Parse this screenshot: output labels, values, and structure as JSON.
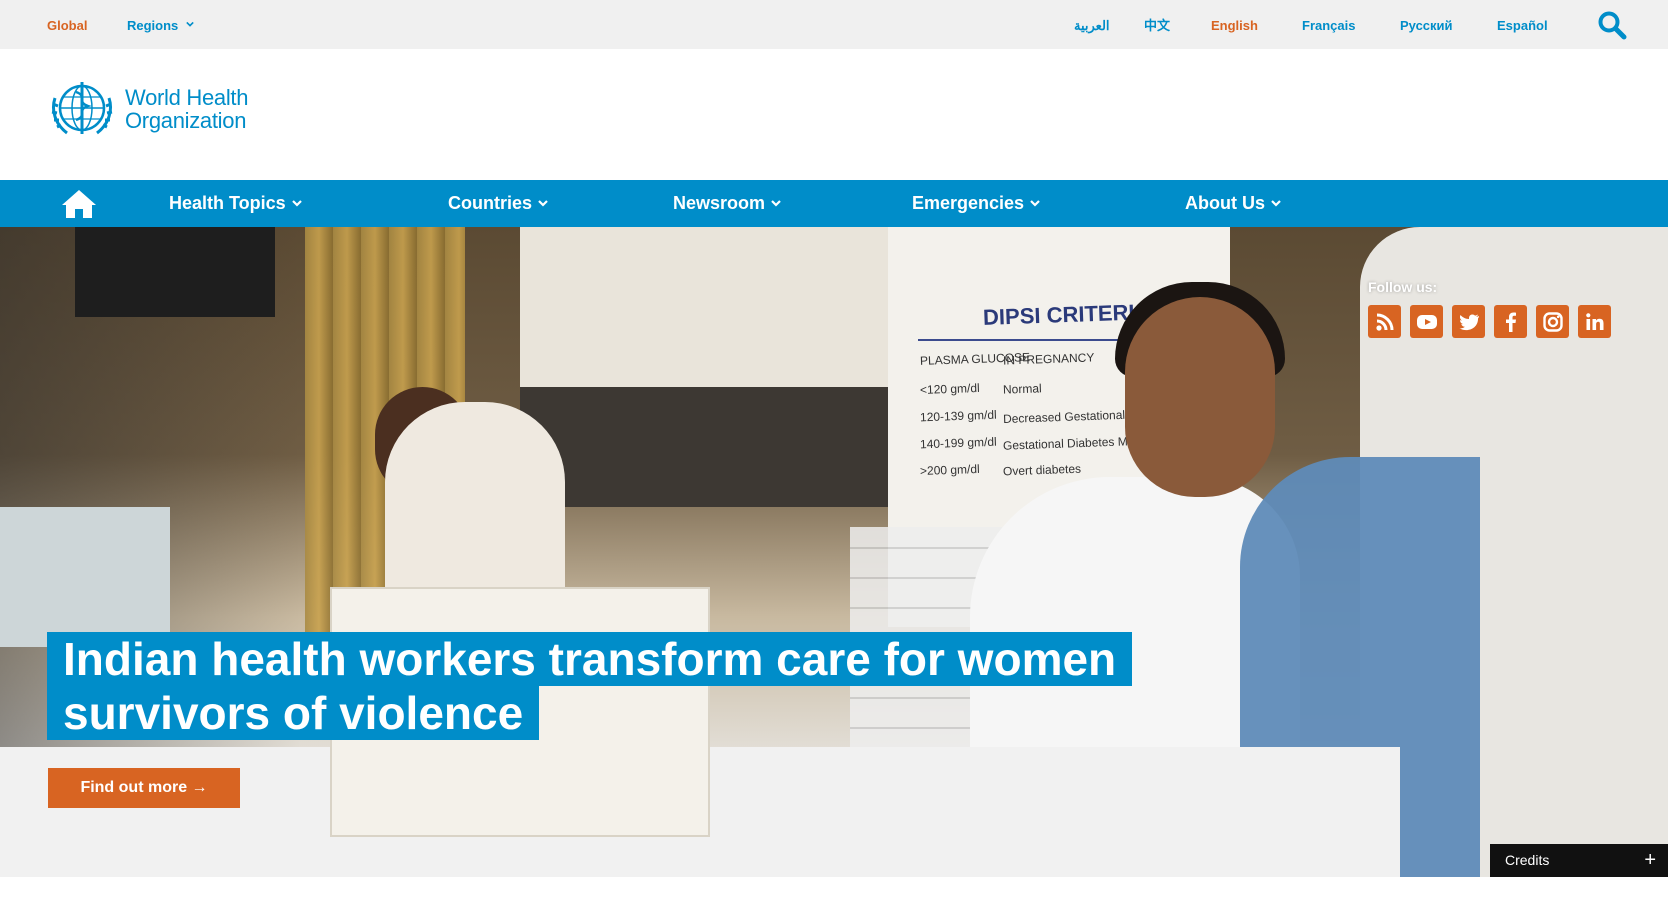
{
  "topbar": {
    "global_label": "Global",
    "regions_label": "Regions",
    "languages": [
      "العربية",
      "中文",
      "English",
      "Français",
      "Русский",
      "Español"
    ],
    "active_language": "English"
  },
  "header": {
    "logo_line1": "World Health",
    "logo_line2": "Organization"
  },
  "nav": {
    "items": [
      "Health Topics",
      "Countries",
      "Newsroom",
      "Emergencies",
      "About Us"
    ]
  },
  "hero": {
    "headline_line1": "Indian health workers transform care for women",
    "headline_line2": "survivors of violence",
    "cta_label": "Find out more →",
    "follow_label": "Follow us:",
    "socials": [
      "rss-icon",
      "youtube-icon",
      "twitter-icon",
      "facebook-icon",
      "instagram-icon",
      "linkedin-icon"
    ],
    "credits_label": "Credits",
    "poster": {
      "title": "DIPSI CRITERIA",
      "col1": "PLASMA GLUCOSE",
      "col2": "IN PREGNANCY",
      "rows": [
        [
          "<120 gm/dl",
          "Normal"
        ],
        [
          "120-139 gm/dl",
          "Decreased Gestational glucose t"
        ],
        [
          "140-199 gm/dl",
          "Gestational Diabetes Mellitus"
        ],
        [
          ">200 gm/dl",
          "Overt diabetes"
        ]
      ]
    }
  },
  "colors": {
    "brand_blue": "#008dc9",
    "accent_orange": "#d86422",
    "topbar_bg": "#f0f0f0"
  }
}
